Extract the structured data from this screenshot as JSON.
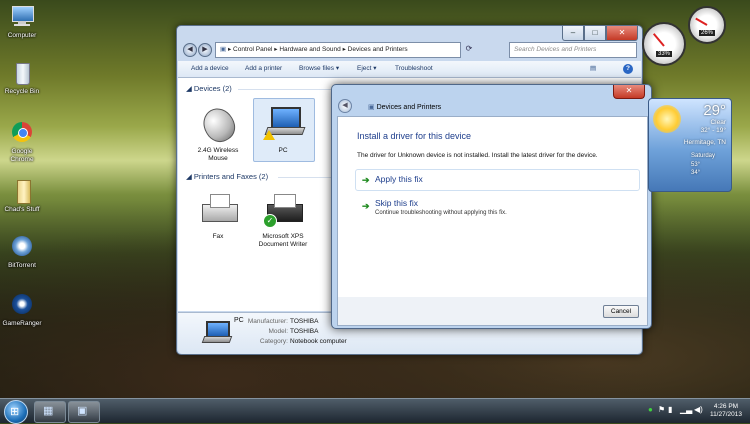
{
  "desktop": {
    "icons": [
      {
        "label": "Computer"
      },
      {
        "label": "Recycle Bin"
      },
      {
        "label": "Google Chrome"
      },
      {
        "label": "Chad's Stuff"
      },
      {
        "label": "BitTorrent"
      },
      {
        "label": "GameRanger"
      }
    ]
  },
  "explorer": {
    "address": {
      "segments": [
        "Control Panel",
        "Hardware and Sound",
        "Devices and Printers"
      ],
      "separator": "▸"
    },
    "search": {
      "placeholder": "Search Devices and Printers"
    },
    "toolbar": {
      "add_device": "Add a device",
      "add_printer": "Add a printer",
      "browse_files": "Browse files",
      "eject": "Eject",
      "troubleshoot": "Troubleshoot",
      "dropdown_glyph": "▾"
    },
    "groups": {
      "devices_title": "Devices (2)",
      "printers_title": "Printers and Faxes (2)"
    },
    "devices": [
      {
        "label": "2.4G Wireless Mouse"
      },
      {
        "label": "PC"
      }
    ],
    "printers": [
      {
        "label": "Fax"
      },
      {
        "label": "Microsoft XPS Document Writer"
      }
    ],
    "details": {
      "name": "PC",
      "manufacturer_label": "Manufacturer:",
      "manufacturer_value": "TOSHIBA",
      "model_label": "Model:",
      "model_value": "TOSHIBA",
      "category_label": "Category:",
      "category_value": "Notebook computer"
    }
  },
  "dialog": {
    "title": "Devices and Printers",
    "heading": "Install a driver for this device",
    "description": "The driver for Unknown device is not installed. Install the latest driver for the device.",
    "options": [
      {
        "title": "Apply this fix",
        "desc": ""
      },
      {
        "title": "Skip this fix",
        "desc": "Continue troubleshooting without applying this fix."
      }
    ],
    "cancel_label": "Cancel"
  },
  "gadgets": {
    "cpu_percent": "33%",
    "ram_percent": "26%",
    "weather": {
      "temp": "29°",
      "condition": "Clear",
      "range": "32° - 19°",
      "location": "Hermitage, TN",
      "day": "Saturday",
      "day_high": "53°",
      "day_low": "34°"
    }
  },
  "taskbar": {
    "time": "4:26 PM",
    "date": "11/27/2013"
  },
  "colors": {
    "link_blue": "#1e3e8c",
    "arrow_green": "#1f8a1f",
    "close_red": "#c43a26"
  }
}
